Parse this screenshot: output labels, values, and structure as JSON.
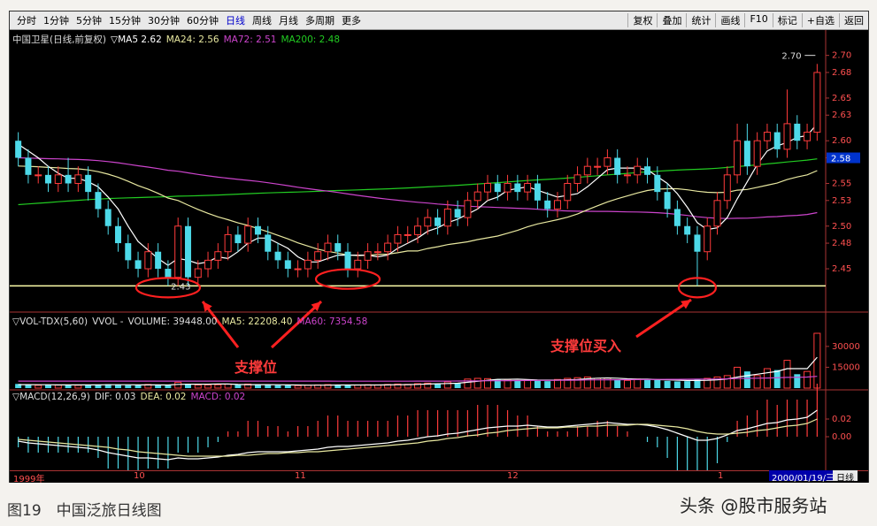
{
  "toolbar": {
    "tabs": [
      "分时",
      "1分钟",
      "5分钟",
      "15分钟",
      "30分钟",
      "60分钟",
      "日线",
      "周线",
      "月线",
      "多周期",
      "更多"
    ],
    "active_tab": "日线",
    "tools": [
      "复权",
      "叠加",
      "统计",
      "画线",
      "F10",
      "标记",
      "+自选",
      "返回"
    ]
  },
  "main_legend": {
    "title": "中国卫星(日线,前复权)",
    "ma5": "▽MA5 2.62",
    "ma24": "MA24: 2.56",
    "ma72": "MA72: 2.51",
    "ma200": "MA200: 2.48"
  },
  "vol_legend": {
    "title": "▽VOL-TDX(5,60)",
    "vvol": "VVOL -",
    "volume": "VOLUME: 39448.00",
    "ma5": "MA5: 22208.40",
    "ma60": "MA60: 7354.58"
  },
  "macd_legend": {
    "title": "▽MACD(12,26,9)",
    "dif": "DIF: 0.03",
    "dea": "DEA: 0.02",
    "macd": "MACD: 0.02"
  },
  "annotations": {
    "low_label": "2.43",
    "high_label": "2.70",
    "current_price": "2.58",
    "support": "支撑位",
    "support_buy": "支撑位买入"
  },
  "bottom": {
    "months": [
      "1999年",
      "10",
      "11",
      "12",
      "1"
    ],
    "date": "2000/01/19/三",
    "daily": "日线"
  },
  "caption": "图19　中国泛旅日线图",
  "watermark": "头条 @股市服务站",
  "colors": {
    "up": "#ff3b3b",
    "down": "#4dd9e8",
    "ma5": "#ffffff",
    "ma24": "#e8e8a0",
    "ma72": "#cc44cc",
    "ma200": "#22cc22",
    "support_line": "#ffffaa"
  },
  "chart_data": {
    "type": "candlestick",
    "price_axis": {
      "ticks": [
        "2.70",
        "2.68",
        "2.65",
        "2.63",
        "2.60",
        "2.58",
        "2.55",
        "2.53",
        "2.50",
        "2.48",
        "2.45"
      ],
      "range": [
        2.42,
        2.71
      ]
    },
    "volume_axis": {
      "ticks": [
        "30000",
        "15000"
      ]
    },
    "macd_axis": {
      "ticks": [
        "0.02",
        "0.00"
      ]
    },
    "support_price": 2.43,
    "candles": [
      [
        2.6,
        2.58,
        2.61,
        2.57
      ],
      [
        2.58,
        2.56,
        2.59,
        2.55
      ],
      [
        2.56,
        2.56,
        2.57,
        2.55
      ],
      [
        2.56,
        2.55,
        2.57,
        2.54
      ],
      [
        2.55,
        2.56,
        2.57,
        2.54
      ],
      [
        2.56,
        2.55,
        2.58,
        2.54
      ],
      [
        2.55,
        2.56,
        2.57,
        2.54
      ],
      [
        2.56,
        2.54,
        2.57,
        2.53
      ],
      [
        2.54,
        2.52,
        2.55,
        2.51
      ],
      [
        2.52,
        2.5,
        2.53,
        2.49
      ],
      [
        2.5,
        2.48,
        2.51,
        2.47
      ],
      [
        2.48,
        2.46,
        2.49,
        2.45
      ],
      [
        2.46,
        2.45,
        2.47,
        2.44
      ],
      [
        2.45,
        2.47,
        2.48,
        2.44
      ],
      [
        2.47,
        2.45,
        2.48,
        2.44
      ],
      [
        2.45,
        2.44,
        2.46,
        2.43
      ],
      [
        2.44,
        2.5,
        2.51,
        2.43
      ],
      [
        2.5,
        2.44,
        2.51,
        2.43
      ],
      [
        2.44,
        2.45,
        2.46,
        2.43
      ],
      [
        2.45,
        2.46,
        2.47,
        2.44
      ],
      [
        2.46,
        2.47,
        2.48,
        2.45
      ],
      [
        2.47,
        2.49,
        2.5,
        2.46
      ],
      [
        2.49,
        2.48,
        2.5,
        2.47
      ],
      [
        2.48,
        2.5,
        2.51,
        2.47
      ],
      [
        2.5,
        2.49,
        2.51,
        2.48
      ],
      [
        2.49,
        2.47,
        2.5,
        2.46
      ],
      [
        2.47,
        2.46,
        2.48,
        2.45
      ],
      [
        2.46,
        2.45,
        2.47,
        2.44
      ],
      [
        2.45,
        2.45,
        2.46,
        2.44
      ],
      [
        2.45,
        2.46,
        2.47,
        2.44
      ],
      [
        2.46,
        2.47,
        2.48,
        2.45
      ],
      [
        2.47,
        2.48,
        2.49,
        2.46
      ],
      [
        2.48,
        2.47,
        2.49,
        2.46
      ],
      [
        2.47,
        2.45,
        2.48,
        2.44
      ],
      [
        2.45,
        2.46,
        2.47,
        2.44
      ],
      [
        2.46,
        2.47,
        2.48,
        2.45
      ],
      [
        2.47,
        2.47,
        2.48,
        2.46
      ],
      [
        2.47,
        2.48,
        2.49,
        2.46
      ],
      [
        2.48,
        2.49,
        2.5,
        2.47
      ],
      [
        2.49,
        2.49,
        2.5,
        2.48
      ],
      [
        2.49,
        2.5,
        2.51,
        2.48
      ],
      [
        2.5,
        2.51,
        2.52,
        2.49
      ],
      [
        2.51,
        2.5,
        2.52,
        2.49
      ],
      [
        2.5,
        2.52,
        2.53,
        2.49
      ],
      [
        2.52,
        2.51,
        2.53,
        2.5
      ],
      [
        2.51,
        2.53,
        2.54,
        2.5
      ],
      [
        2.53,
        2.54,
        2.55,
        2.52
      ],
      [
        2.54,
        2.55,
        2.56,
        2.53
      ],
      [
        2.55,
        2.54,
        2.56,
        2.53
      ],
      [
        2.54,
        2.55,
        2.56,
        2.53
      ],
      [
        2.55,
        2.54,
        2.56,
        2.53
      ],
      [
        2.54,
        2.55,
        2.56,
        2.53
      ],
      [
        2.55,
        2.53,
        2.56,
        2.52
      ],
      [
        2.53,
        2.52,
        2.54,
        2.51
      ],
      [
        2.52,
        2.53,
        2.54,
        2.51
      ],
      [
        2.53,
        2.55,
        2.56,
        2.52
      ],
      [
        2.55,
        2.56,
        2.57,
        2.54
      ],
      [
        2.56,
        2.57,
        2.58,
        2.55
      ],
      [
        2.57,
        2.57,
        2.58,
        2.56
      ],
      [
        2.57,
        2.58,
        2.59,
        2.56
      ],
      [
        2.58,
        2.56,
        2.59,
        2.55
      ],
      [
        2.56,
        2.56,
        2.57,
        2.55
      ],
      [
        2.56,
        2.57,
        2.58,
        2.55
      ],
      [
        2.57,
        2.56,
        2.58,
        2.55
      ],
      [
        2.56,
        2.54,
        2.57,
        2.53
      ],
      [
        2.54,
        2.52,
        2.55,
        2.51
      ],
      [
        2.52,
        2.5,
        2.53,
        2.49
      ],
      [
        2.5,
        2.49,
        2.51,
        2.48
      ],
      [
        2.49,
        2.47,
        2.5,
        2.43
      ],
      [
        2.47,
        2.5,
        2.51,
        2.46
      ],
      [
        2.5,
        2.53,
        2.54,
        2.49
      ],
      [
        2.53,
        2.56,
        2.57,
        2.52
      ],
      [
        2.56,
        2.6,
        2.62,
        2.55
      ],
      [
        2.6,
        2.57,
        2.62,
        2.56
      ],
      [
        2.57,
        2.6,
        2.61,
        2.56
      ],
      [
        2.6,
        2.61,
        2.62,
        2.59
      ],
      [
        2.61,
        2.59,
        2.62,
        2.58
      ],
      [
        2.59,
        2.62,
        2.66,
        2.58
      ],
      [
        2.62,
        2.6,
        2.63,
        2.59
      ],
      [
        2.6,
        2.61,
        2.62,
        2.59
      ],
      [
        2.61,
        2.68,
        2.69,
        2.6
      ]
    ],
    "volumes": [
      3000,
      2500,
      2000,
      2200,
      2100,
      2400,
      2000,
      2300,
      2600,
      2800,
      2400,
      2100,
      1900,
      2600,
      2200,
      2000,
      4200,
      3000,
      2200,
      2300,
      2400,
      2800,
      2300,
      2900,
      2400,
      2200,
      2100,
      1900,
      1800,
      2100,
      2300,
      2500,
      2100,
      2000,
      2200,
      2400,
      2300,
      2600,
      2900,
      2700,
      3200,
      3600,
      3000,
      4500,
      3500,
      6500,
      7000,
      6800,
      6000,
      6200,
      5500,
      6000,
      5800,
      5000,
      6200,
      7000,
      7500,
      8000,
      7000,
      7200,
      6000,
      5500,
      6500,
      6000,
      5800,
      5200,
      4800,
      5000,
      6000,
      7000,
      8000,
      9000,
      15000,
      12000,
      9000,
      14000,
      13000,
      20000,
      10000,
      12000,
      39448
    ],
    "vol_ma5": [
      2500,
      2500,
      2400,
      2400,
      2300,
      2300,
      2300,
      2300,
      2300,
      2400,
      2400,
      2400,
      2300,
      2300,
      2300,
      2200,
      2700,
      2800,
      2800,
      2800,
      2900,
      2900,
      2600,
      2500,
      2500,
      2500,
      2400,
      2300,
      2200,
      2100,
      2100,
      2100,
      2200,
      2200,
      2200,
      2200,
      2200,
      2300,
      2400,
      2500,
      2700,
      2900,
      3100,
      3300,
      3500,
      4200,
      4900,
      5600,
      6300,
      6300,
      6400,
      6100,
      5800,
      5700,
      5700,
      6000,
      6200,
      6700,
      7100,
      7300,
      7100,
      6700,
      6500,
      6400,
      6100,
      5900,
      5700,
      5500,
      5500,
      5600,
      6000,
      6600,
      7900,
      9000,
      10000,
      11000,
      12000,
      14000,
      14000,
      14000,
      22208
    ],
    "macd_dif": [
      -0.005,
      -0.007,
      -0.008,
      -0.009,
      -0.01,
      -0.011,
      -0.012,
      -0.013,
      -0.015,
      -0.018,
      -0.02,
      -0.022,
      -0.024,
      -0.024,
      -0.025,
      -0.026,
      -0.024,
      -0.025,
      -0.025,
      -0.024,
      -0.023,
      -0.021,
      -0.02,
      -0.018,
      -0.017,
      -0.017,
      -0.017,
      -0.017,
      -0.016,
      -0.015,
      -0.014,
      -0.012,
      -0.011,
      -0.011,
      -0.01,
      -0.009,
      -0.008,
      -0.007,
      -0.005,
      -0.004,
      -0.002,
      0.0,
      0.001,
      0.003,
      0.004,
      0.006,
      0.008,
      0.01,
      0.011,
      0.012,
      0.012,
      0.013,
      0.012,
      0.011,
      0.011,
      0.012,
      0.013,
      0.014,
      0.015,
      0.016,
      0.015,
      0.014,
      0.014,
      0.013,
      0.011,
      0.008,
      0.004,
      0.0,
      -0.004,
      -0.004,
      -0.002,
      0.002,
      0.007,
      0.009,
      0.012,
      0.015,
      0.016,
      0.019,
      0.02,
      0.022,
      0.03
    ],
    "macd_dea": [
      -0.003,
      -0.004,
      -0.005,
      -0.006,
      -0.007,
      -0.008,
      -0.009,
      -0.01,
      -0.011,
      -0.012,
      -0.014,
      -0.015,
      -0.017,
      -0.018,
      -0.019,
      -0.02,
      -0.021,
      -0.022,
      -0.022,
      -0.022,
      -0.022,
      -0.022,
      -0.021,
      -0.021,
      -0.02,
      -0.019,
      -0.019,
      -0.018,
      -0.018,
      -0.017,
      -0.017,
      -0.016,
      -0.015,
      -0.014,
      -0.013,
      -0.012,
      -0.011,
      -0.01,
      -0.009,
      -0.008,
      -0.007,
      -0.005,
      -0.004,
      -0.002,
      -0.001,
      0.001,
      0.002,
      0.004,
      0.005,
      0.007,
      0.008,
      0.009,
      0.01,
      0.01,
      0.01,
      0.011,
      0.011,
      0.012,
      0.012,
      0.013,
      0.013,
      0.013,
      0.014,
      0.014,
      0.013,
      0.012,
      0.011,
      0.009,
      0.006,
      0.004,
      0.003,
      0.003,
      0.004,
      0.005,
      0.007,
      0.008,
      0.01,
      0.012,
      0.013,
      0.015,
      0.02
    ]
  }
}
